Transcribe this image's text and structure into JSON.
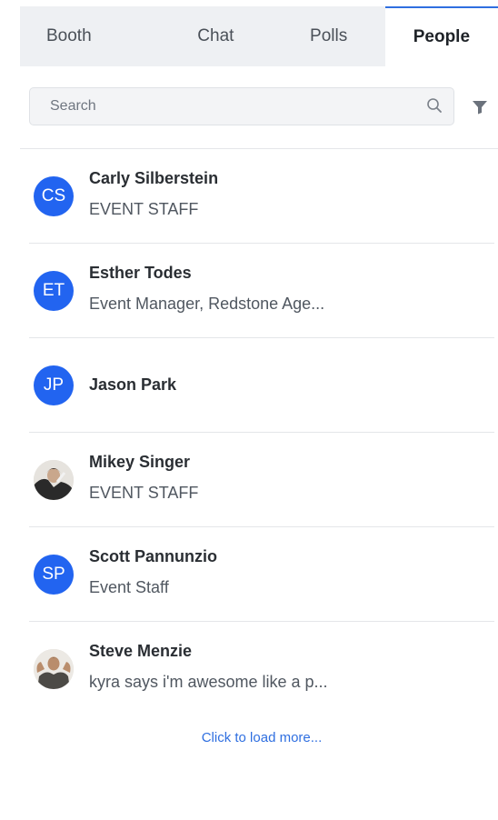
{
  "tabs": [
    {
      "label": "Booth"
    },
    {
      "label": "Chat"
    },
    {
      "label": "Polls"
    },
    {
      "label": "People"
    }
  ],
  "active_tab": "People",
  "search": {
    "placeholder": "Search",
    "value": ""
  },
  "people": [
    {
      "name": "Carly Silberstein",
      "title": "EVENT STAFF",
      "initials": "CS",
      "avatar": "initials"
    },
    {
      "name": "Esther Todes",
      "title": "Event Manager, Redstone Age...",
      "initials": "ET",
      "avatar": "initials"
    },
    {
      "name": "Jason Park",
      "title": "",
      "initials": "JP",
      "avatar": "initials"
    },
    {
      "name": "Mikey Singer",
      "title": "EVENT STAFF",
      "initials": "",
      "avatar": "photo"
    },
    {
      "name": "Scott Pannunzio",
      "title": "Event Staff",
      "initials": "SP",
      "avatar": "initials"
    },
    {
      "name": "Steve Menzie",
      "title": "kyra says i'm awesome like a p...",
      "initials": "",
      "avatar": "photo"
    }
  ],
  "load_more_label": "Click to load more...",
  "colors": {
    "accent": "#2f6fe0",
    "avatar_bg": "#2264f0",
    "tab_bar_bg": "#eef0f3"
  }
}
